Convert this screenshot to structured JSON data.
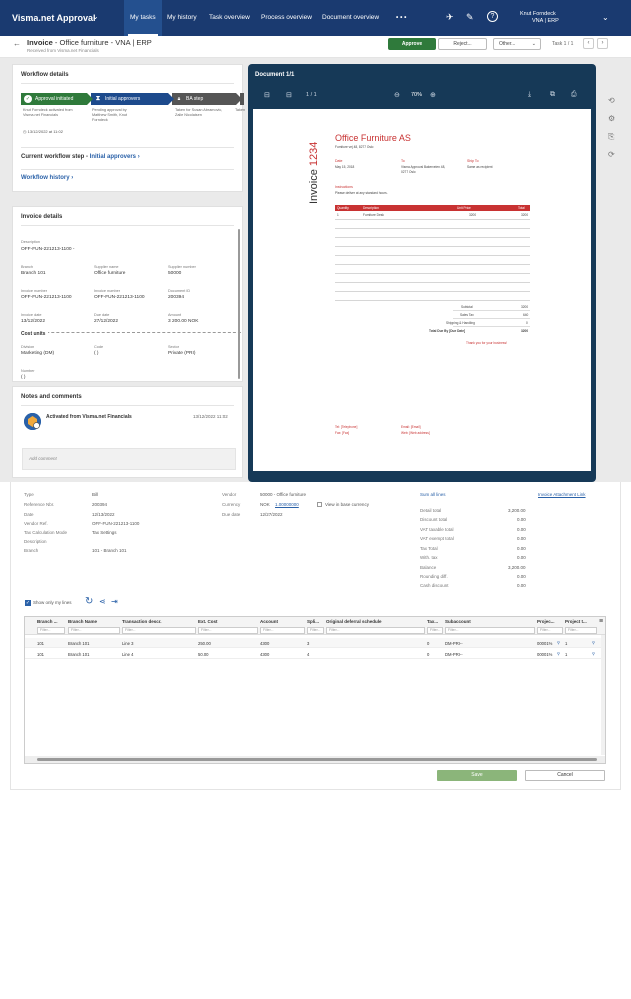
{
  "topbar": {
    "brand": "Visma.net Approval",
    "nav": [
      "My tasks",
      "My history",
      "Task overview",
      "Process overview",
      "Document overview"
    ],
    "more": "• • •",
    "user_name": "Knut Forndeck",
    "user_role": "VNA | ERP"
  },
  "header": {
    "title_bold": "Invoice",
    "title_rest": " - Office furniture  - VNA | ERP",
    "subtitle": "Received from Visma.net Financials",
    "approve": "Approve",
    "reject": "Reject...",
    "other": "Other...",
    "task_counter": "Task 1 / 1"
  },
  "workflow": {
    "title": "Workflow details",
    "steps": [
      {
        "label": "Approval initiated",
        "desc": "Knut Forndeck activated from Visma.net Financials"
      },
      {
        "label": "Initial approvers",
        "desc": "Pending approval by Matthew Smith, Knut Forndeck"
      },
      {
        "label": "BA step",
        "desc": "Taken for Susan Abramovic, Zalie Nicolaisen"
      },
      {
        "label": "",
        "desc": "Taken"
      }
    ],
    "date": "13/12/2022 at 11:02",
    "current_label": "Current workflow step - ",
    "current_value": "Initial approvers",
    "history": "Workflow history"
  },
  "invoice": {
    "title": "Invoice details",
    "description_label": "Description",
    "description": "OFF-FUN-221213-1100 -",
    "fields": [
      {
        "label": "Branch",
        "value": "Branch 101"
      },
      {
        "label": "Supplier name",
        "value": "Office furniture"
      },
      {
        "label": "Supplier number",
        "value": "50000"
      },
      {
        "label": "Invoice number",
        "value": "OFF-FUN-221213-1100"
      },
      {
        "label": "Invoice number",
        "value": "OFF-FUN-221213-1100"
      },
      {
        "label": "Document ID",
        "value": "200394"
      },
      {
        "label": "Invoice date",
        "value": "13/12/2022"
      },
      {
        "label": "Due date",
        "value": "27/12/2022"
      },
      {
        "label": "Amount",
        "value": "3 200.00 NOK"
      }
    ],
    "cost_units": "Cost units",
    "cost_fields": [
      {
        "label": "Division",
        "value": "Marketing (DM)"
      },
      {
        "label": "Code",
        "value": "( )"
      },
      {
        "label": "Sector",
        "value": "Private (PRI)"
      }
    ],
    "number_label": "Number",
    "number_value": "( )"
  },
  "notes": {
    "title": "Notes and comments",
    "activity": "Activated from Visma.net Financials",
    "date": "13/12/2022 11:02",
    "placeholder": "Add comment"
  },
  "document": {
    "title": "Document 1/1",
    "page": "1 / 1",
    "zoom": "70%",
    "invoice_word": "Invoice",
    "invoice_no": "1234",
    "company": "Office Furniture AS",
    "company_addr": "Furniture vej 48, 8277 Oslo",
    "date_label": "Date",
    "date_value": "May 15, 2018",
    "to_label": "To",
    "to_value": "Visma Approval Bakerveien 48, 0277 Oslo",
    "ship_label": "Ship To",
    "ship_value": "Same as recipient",
    "instructions_label": "Instructions",
    "instructions_value": "Please deliver at any standard hours.",
    "cols": [
      "Quantity",
      "Description",
      "Unit Price",
      "Total"
    ],
    "row": [
      "1",
      "Furniture Desk",
      "3200",
      "3200"
    ],
    "totals": [
      {
        "label": "Subtotal",
        "value": "3200"
      },
      {
        "label": "Sales Tax",
        "value": "640"
      },
      {
        "label": "Shipping & Handling",
        "value": "0"
      },
      {
        "label": "Total Due By [Due Date]",
        "value": "3200"
      }
    ],
    "thanks": "Thank you for your business!",
    "tel": "Tel: [Telephone]",
    "fax": "Fax: [Fax]",
    "email": "Email: [Email]",
    "web": "Web: [Web address]"
  },
  "details": {
    "left": [
      {
        "label": "Type",
        "value": "Bill"
      },
      {
        "label": "Reference Nbr.",
        "value": "200394"
      },
      {
        "label": "Date",
        "value": "12/13/2022"
      },
      {
        "label": "Vendor Ref.",
        "value": "OFF-FUN-221213-1100"
      },
      {
        "label": "Tax Calculation Mode",
        "value": "Tax Settings"
      },
      {
        "label": "Description",
        "value": ""
      },
      {
        "label": "Branch",
        "value": "101 - Branch 101"
      }
    ],
    "vendor_label": "Vendor",
    "vendor_value": "50000 - Office furniture",
    "currency_label": "Currency",
    "currency_code": "NOK",
    "currency_rate": "1.00000000",
    "base_currency": "View in base currency",
    "duedate_label": "Due date",
    "duedate_value": "12/27/2022",
    "sum_all": "Sum all lines",
    "attach_link": "Invoice Attachment Link",
    "totals": [
      {
        "label": "Detail total",
        "value": "3,200.00"
      },
      {
        "label": "Discount total",
        "value": "0.00"
      },
      {
        "label": "VAT taxable total",
        "value": "0.00"
      },
      {
        "label": "VAT exempt total",
        "value": "0.00"
      },
      {
        "label": "Tax Total",
        "value": "0.00"
      },
      {
        "label": "With. tax",
        "value": "0.00"
      },
      {
        "label": "Balance",
        "value": "3,200.00"
      },
      {
        "label": "Rounding diff.",
        "value": "0.00"
      },
      {
        "label": "Cash discount",
        "value": "0.00"
      }
    ]
  },
  "grid": {
    "show_only": "Show only my lines",
    "headers": [
      "Branch ...",
      "Branch Name",
      "Transaction descr.",
      "Ext. Cost",
      "Account",
      "Spli...",
      "Original deferral schedule",
      "Tax...",
      "Subaccount",
      "Projec...",
      "Project t..."
    ],
    "filter": "Filter...",
    "rows": [
      [
        "101",
        "Branch 101",
        "Line 3",
        "250.00",
        "4300",
        "3",
        "",
        "0",
        "DM-PRI--",
        "00001%",
        "1"
      ],
      [
        "101",
        "Branch 101",
        "Line 4",
        "50.00",
        "4300",
        "4",
        "",
        "0",
        "DM-PRI--",
        "00001%",
        "1"
      ]
    ],
    "save": "Save",
    "cancel": "Cancel"
  },
  "colors": {
    "topbar": "#1a3a70",
    "approve": "#2f7a3b",
    "link": "#2a61a8",
    "doc_bg": "#163957",
    "invoice_red": "#c83232"
  }
}
